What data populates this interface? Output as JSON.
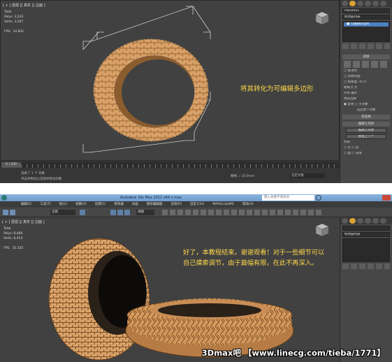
{
  "top": {
    "viewport_label": "[ + ] 透视 ][ 真实 ][ 边面 ]",
    "stats": [
      "Total",
      "Polys: 3,233",
      "Verts: 3,207",
      "",
      "FPS:  34.831"
    ],
    "caption": "将其转化为可编辑多边形",
    "command_panel": {
      "object_name": "Plane001",
      "modifier_list": "修改器列表",
      "stack_item": "■ 可编辑多边形",
      "rollouts": {
        "selection": "选择",
        "soft_selection": "软选择",
        "edit_geometry": "编辑几何体"
      },
      "rows": [
        "□ 按顶点",
        "□ 忽略背面",
        "□ 按角度: 45.0",
        "收缩    扩大",
        "环形    循环",
        "预览选择",
        "● 禁用  ○ 子对象",
        "选定整个对象"
      ],
      "buttons": [
        "编辑几何体",
        "重复上一个"
      ],
      "constraints_label": "约束",
      "constraints": [
        "○ 无    ○ 边",
        "○ 面    ○ 法线"
      ]
    },
    "timeline": {
      "frame": "0 / 100"
    },
    "status": {
      "selection": "选择了 1 个 对象",
      "hint": "单击并拖动以选择并移动对象",
      "grid": "栅格 = 10.0mm",
      "mode": "选定对象"
    }
  },
  "bottom": {
    "title": "Autodesk 3ds Max  2012 x64    z.max",
    "search_placeholder": "键入关键字或短语",
    "menus": [
      "编辑(E)",
      "工具(T)",
      "组(G)",
      "视图(V)",
      "创建(C)",
      "修改器",
      "动画",
      "图形编辑器",
      "渲染(R)",
      "自定义(U)",
      "MAXScript(M)",
      "帮助(H)"
    ],
    "toolbar_dropdowns": {
      "filter": "全部",
      "view": "视图"
    },
    "viewport_label": "[ + ] 透视 ][ 真实 ][ 边面 ]",
    "stats": [
      "Total",
      "Polys: 8,466",
      "Verts: 8,414",
      "",
      "FPS:  35.325"
    ],
    "caption_lines": [
      "好了，本教程结束。谢谢观看！对于一些细节可以",
      "自己摸索调节，由于篇幅有限，在此不再深入。"
    ],
    "command_panel": {
      "modifier_list": "修改器列表"
    },
    "watermark": "3Dmax吧 【www.linecg.com/tieba/1771】"
  },
  "colors": {
    "tire": "#d9a065",
    "caption": "#ffd84a",
    "accent": "#d9a232",
    "selection": "#4c7fc0"
  },
  "icons": [
    "viewcube-icon",
    "create-tab-icon",
    "modify-tab-icon",
    "hierarchy-tab-icon",
    "motion-tab-icon",
    "display-tab-icon",
    "utilities-tab-icon",
    "undo-icon",
    "redo-icon",
    "select-icon",
    "move-icon",
    "rotate-icon",
    "scale-icon",
    "app-logo-icon",
    "search-icon"
  ]
}
